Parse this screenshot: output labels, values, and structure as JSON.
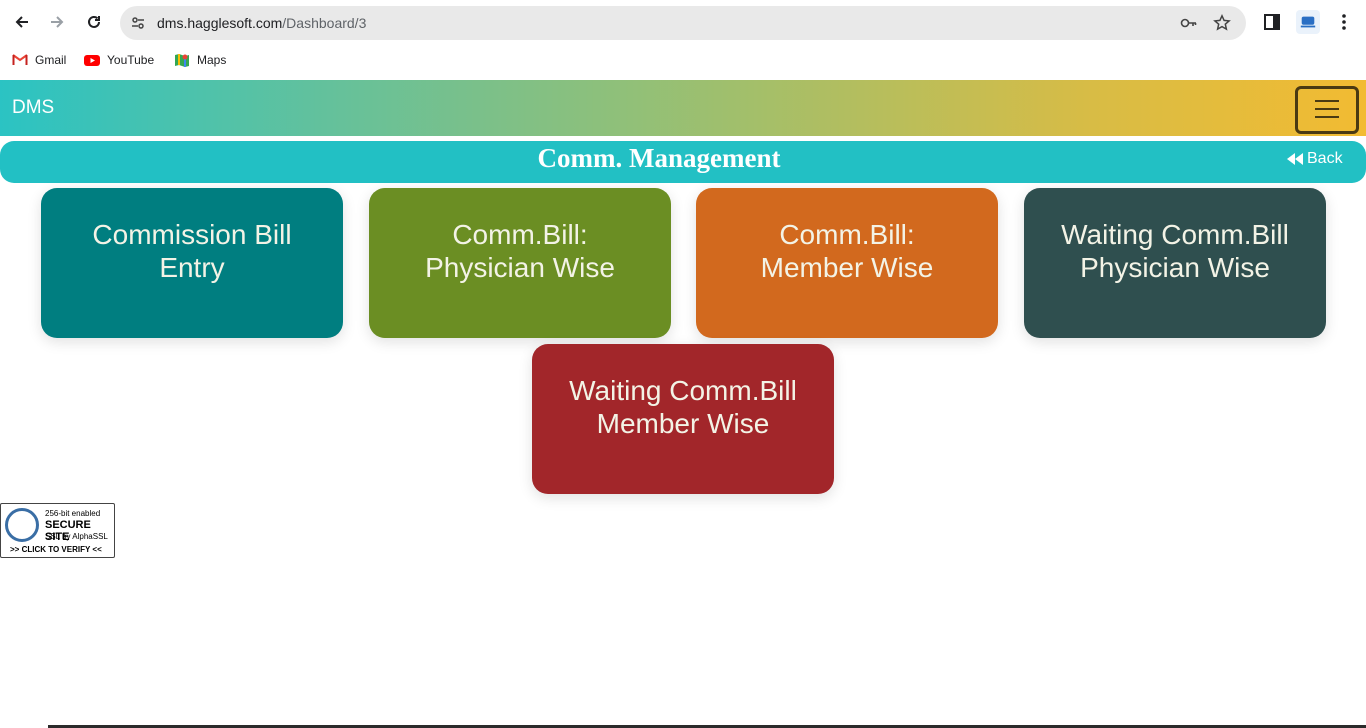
{
  "browser": {
    "url_host": "dms.hagglesoft.com",
    "url_path": "/Dashboard/3",
    "bookmarks": [
      {
        "label": "Gmail",
        "icon": "gmail-icon"
      },
      {
        "label": "YouTube",
        "icon": "youtube-icon"
      },
      {
        "label": "Maps",
        "icon": "maps-icon"
      }
    ]
  },
  "navbar": {
    "brand": "DMS",
    "menu_icon": "hamburger-icon"
  },
  "header": {
    "title": "Comm. Management",
    "back_label": "Back",
    "back_icon": "backward-icon"
  },
  "tiles": [
    {
      "line1": "Commission Bill",
      "line2": "Entry",
      "color": "#007e80"
    },
    {
      "line1": "Comm.Bill:",
      "line2": "Physician Wise",
      "color": "#6b8e23"
    },
    {
      "line1": "Comm.Bill:",
      "line2": "Member Wise",
      "color": "#d2691e"
    },
    {
      "line1": "Waiting Comm.Bill",
      "line2": "Physician Wise",
      "color": "#2f4f4f"
    },
    {
      "line1": "Waiting Comm.Bill",
      "line2": "Member Wise",
      "color": "#a2262a"
    }
  ],
  "ssl_badge": {
    "top": "256-bit enabled",
    "title": "SECURE SITE",
    "by": "SSL by AlphaSSL",
    "verify": ">> CLICK TO VERIFY <<"
  }
}
